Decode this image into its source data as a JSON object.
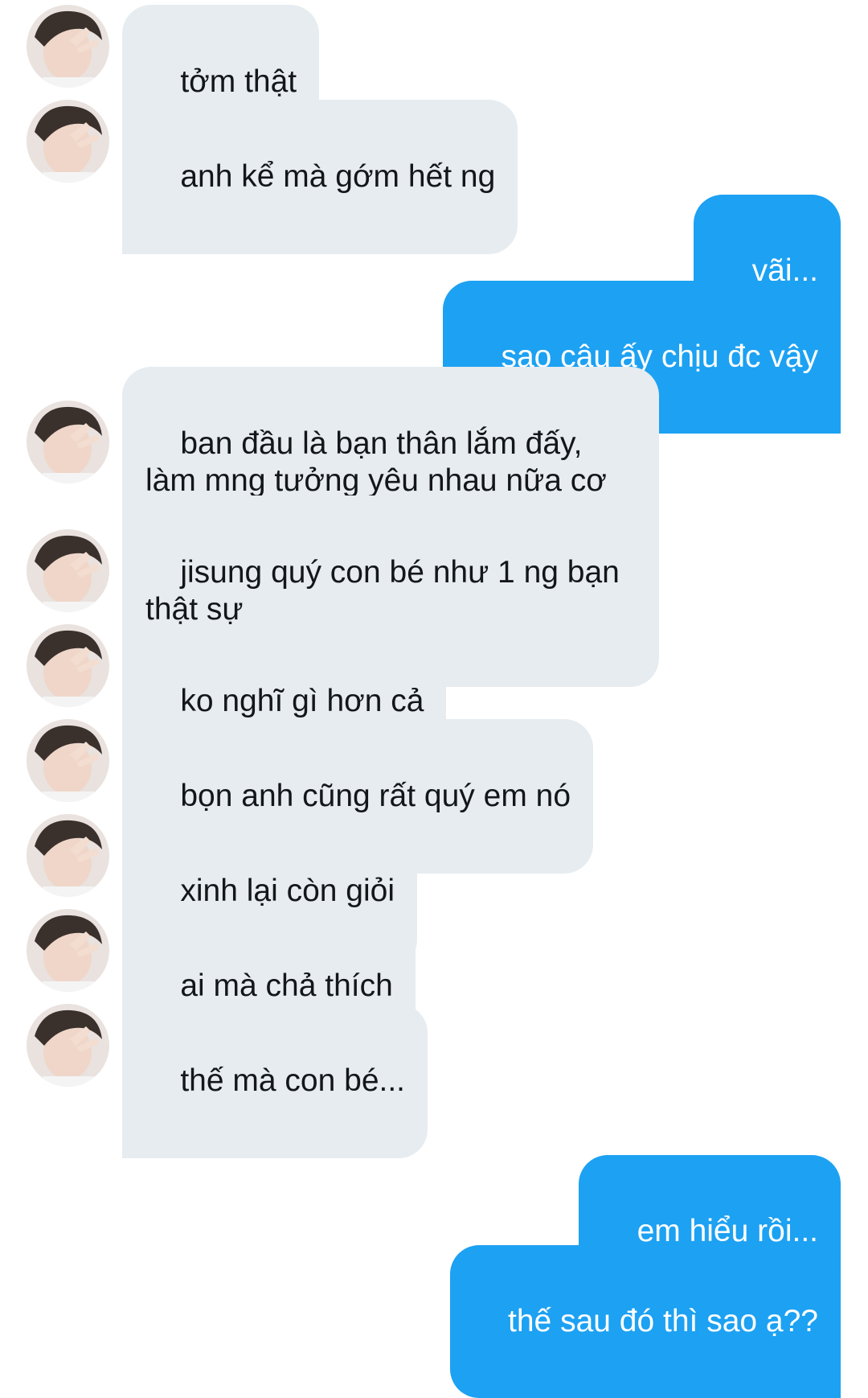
{
  "conversation": {
    "colors": {
      "incoming_bubble": "#e6ecf0",
      "outgoing_bubble": "#1da1f2",
      "incoming_text": "#14171a",
      "outgoing_text": "#ffffff"
    },
    "messages": [
      {
        "side": "incoming",
        "text": "tởm thật"
      },
      {
        "side": "incoming",
        "text": "anh kể mà gớm hết ng"
      },
      {
        "side": "outgoing",
        "text": "vãi..."
      },
      {
        "side": "outgoing",
        "text": "sao cậu ấy chịu đc vậy"
      },
      {
        "side": "incoming",
        "text": "ban đầu là bạn thân lắm đấy, làm mng tưởng yêu nhau nữa cơ"
      },
      {
        "side": "incoming",
        "text": "jisung quý con bé như 1 ng bạn thật sự"
      },
      {
        "side": "incoming",
        "text": "ko nghĩ gì hơn cả"
      },
      {
        "side": "incoming",
        "text": "bọn anh cũng rất quý em nó"
      },
      {
        "side": "incoming",
        "text": "xinh lại còn giỏi"
      },
      {
        "side": "incoming",
        "text": "ai mà chả thích"
      },
      {
        "side": "incoming",
        "text": "thế mà con bé..."
      },
      {
        "side": "outgoing",
        "text": "em hiểu rồi..."
      },
      {
        "side": "outgoing",
        "text": "thế sau đó thì sao ạ??"
      }
    ]
  }
}
